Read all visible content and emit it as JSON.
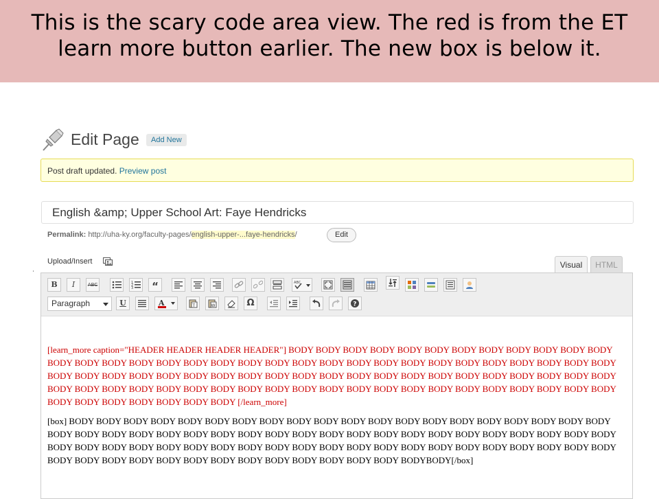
{
  "banner": {
    "line1": "This is the scary code area view.  The red is from the ET",
    "line2": "learn more button earlier.  The new box is below it."
  },
  "header": {
    "title": "Edit Page",
    "add_new_label": "Add New",
    "icon": "pushpin-icon"
  },
  "notice": {
    "text": "Post draft updated. ",
    "link_label": "Preview post"
  },
  "title_field": {
    "value": "English &amp; Upper School Art: Faye Hendricks"
  },
  "permalink": {
    "label": "Permalink:",
    "base": "http://uha-ky.org/faculty-pages/",
    "slug": "english-upper-...faye-hendricks",
    "trailing": "/",
    "edit_label": "Edit"
  },
  "upload": {
    "label": "Upload/Insert",
    "icon": "media-icon"
  },
  "tabs": {
    "visual": "Visual",
    "html": "HTML"
  },
  "toolbar": {
    "row1": [
      "bold-icon",
      "italic-icon",
      "strikethrough-icon",
      "bulleted-list-icon",
      "numbered-list-icon",
      "blockquote-icon",
      "align-left-icon",
      "align-center-icon",
      "align-right-icon",
      "link-icon",
      "unlink-icon",
      "more-tag-icon",
      "spellcheck-icon",
      "fullscreen-icon",
      "kitchen-sink-icon",
      "table-icon",
      "shortcode-icon",
      "columns-icon",
      "button-icon",
      "box-icon",
      "member-icon"
    ],
    "format_value": "Paragraph",
    "row2": [
      "underline-icon",
      "justify-icon",
      "text-color-icon",
      "paste-text-icon",
      "paste-word-icon",
      "clear-format-icon",
      "special-char-icon",
      "outdent-icon",
      "indent-icon",
      "undo-icon",
      "redo-icon",
      "help-icon"
    ]
  },
  "content": {
    "red_paragraph": "[learn_more caption=\"HEADER HEADER HEADER HEADER\"] BODY BODY BODY BODY BODY BODY BODY BODY BODY BODY BODY BODY BODY BODY BODY BODY BODY BODY BODY BODY BODY BODY BODY BODY BODY BODY BODY BODY BODY BODY BODY BODY BODY BODY BODY BODY BODY BODY BODY BODY BODY BODY BODY BODY BODY BODY BODY BODY BODY BODY BODY BODY BODY BODY BODY BODY BODY BODY BODY BODY BODY BODY BODY BODY BODY BODY BODY BODY BODY BODY BODY BODY BODY BODY BODY BODY BODY BODY BODY BODY BODY BODY [/learn_more]",
    "black_paragraph": "[box] BODY BODY BODY BODY BODY BODY BODY BODY BODY BODY BODY BODY BODY BODY BODY BODY BODY BODY BODY BODY BODY BODY BODY BODY BODY BODY BODY BODY BODY BODY BODY BODY BODY BODY BODY BODY BODY BODY BODY BODY BODY BODY BODY BODY BODY BODY BODY BODY BODY BODY BODY BODY BODY BODY BODY BODY BODY BODY BODY BODY BODY BODY BODY BODY BODY BODY BODY BODY BODY BODY BODY BODY BODY BODY BODY BODYBODY[/box]"
  },
  "colors": {
    "banner_bg": "#e6b9b8",
    "red_text": "#cc0000",
    "link": "#21759b",
    "notice_bg": "#ffffe0"
  }
}
